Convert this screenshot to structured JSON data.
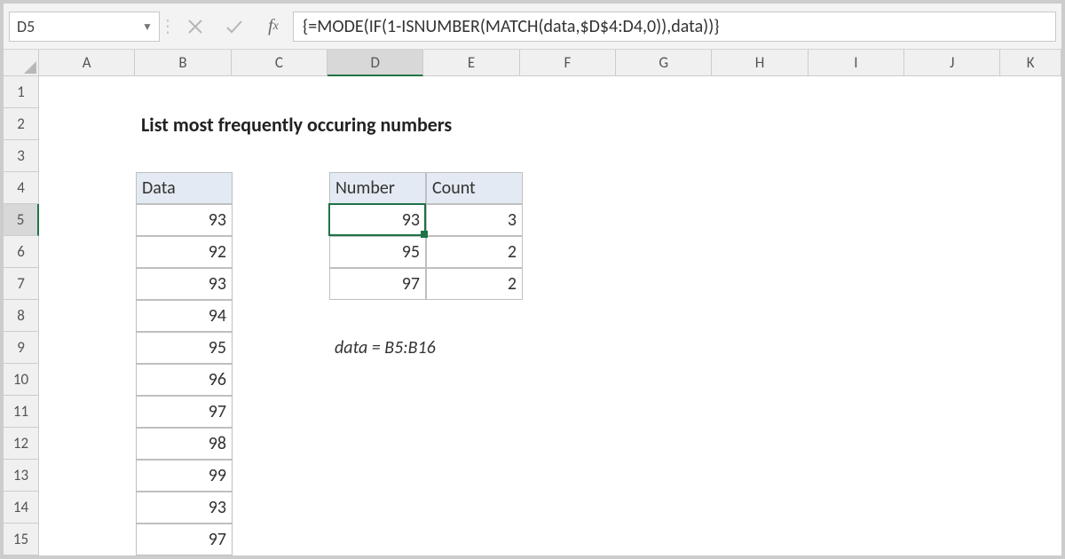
{
  "name_box": "D5",
  "formula_text": "{=MODE(IF(1-ISNUMBER(MATCH(data,$D$4:D4,0)),data))}",
  "columns": [
    {
      "letter": "A",
      "width": 109
    },
    {
      "letter": "B",
      "width": 109
    },
    {
      "letter": "C",
      "width": 109
    },
    {
      "letter": "D",
      "width": 109
    },
    {
      "letter": "E",
      "width": 109
    },
    {
      "letter": "F",
      "width": 109
    },
    {
      "letter": "G",
      "width": 109
    },
    {
      "letter": "H",
      "width": 109
    },
    {
      "letter": "I",
      "width": 109
    },
    {
      "letter": "J",
      "width": 109
    },
    {
      "letter": "K",
      "width": 69
    }
  ],
  "rows": [
    {
      "n": 1,
      "h": 36
    },
    {
      "n": 2,
      "h": 36
    },
    {
      "n": 3,
      "h": 36
    },
    {
      "n": 4,
      "h": 36
    },
    {
      "n": 5,
      "h": 36
    },
    {
      "n": 6,
      "h": 36
    },
    {
      "n": 7,
      "h": 36
    },
    {
      "n": 8,
      "h": 36
    },
    {
      "n": 9,
      "h": 36
    },
    {
      "n": 10,
      "h": 36
    },
    {
      "n": 11,
      "h": 36
    },
    {
      "n": 12,
      "h": 36
    },
    {
      "n": 13,
      "h": 36
    },
    {
      "n": 14,
      "h": 36
    },
    {
      "n": 15,
      "h": 36
    }
  ],
  "selected_col": "D",
  "selected_row": 5,
  "title": "List most frequently occuring numbers",
  "data_header": "Data",
  "number_header": "Number",
  "count_header": "Count",
  "data_values": [
    "93",
    "92",
    "93",
    "94",
    "95",
    "96",
    "97",
    "98",
    "99",
    "93",
    "97"
  ],
  "results": [
    {
      "number": "93",
      "count": "3"
    },
    {
      "number": "95",
      "count": "2"
    },
    {
      "number": "97",
      "count": "2"
    }
  ],
  "note": "data = B5:B16"
}
